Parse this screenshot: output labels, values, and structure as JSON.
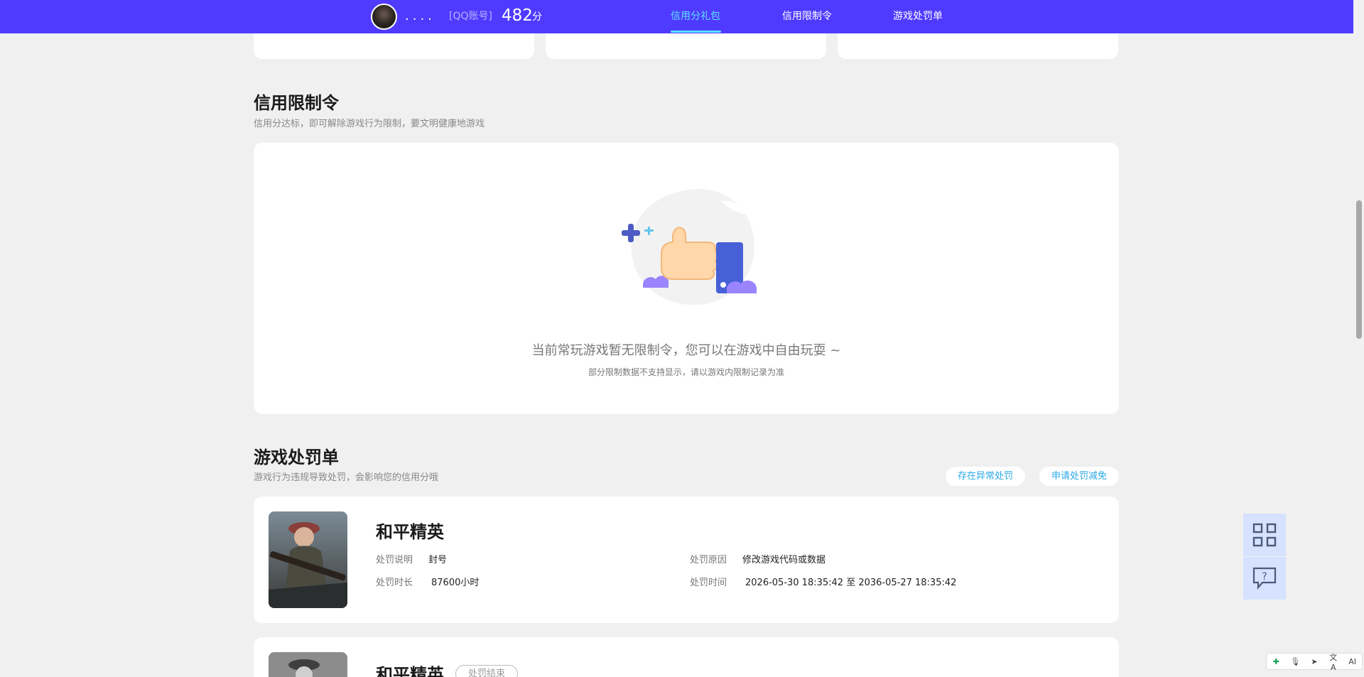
{
  "header": {
    "nickname": "....",
    "account_type": "[QQ账号]",
    "score": "482",
    "score_unit": "分",
    "nav": [
      {
        "label": "信用分礼包",
        "active": true
      },
      {
        "label": "信用限制令",
        "active": false
      },
      {
        "label": "游戏处罚单",
        "active": false
      }
    ]
  },
  "restriction": {
    "title": "信用限制令",
    "subtitle": "信用分达标，即可解除游戏行为限制，要文明健康地游戏",
    "empty_text": "当前常玩游戏暂无限制令，您可以在游戏中自由玩耍 ~",
    "empty_note": "部分限制数据不支持显示，请以游戏内限制记录为准"
  },
  "penalty": {
    "title": "游戏处罚单",
    "subtitle": "游戏行为违规导致处罚，会影响您的信用分哦",
    "buttons": [
      "存在异常处罚",
      "申请处罚减免"
    ],
    "items": [
      {
        "game": "和平精英",
        "labels": {
          "desc": "处罚说明",
          "reason": "处罚原因",
          "duration": "处罚时长",
          "time": "处罚时间"
        },
        "desc": "封号",
        "reason": "修改游戏代码或数据",
        "duration": "87600小时",
        "time": "2026-05-30 18:35:42 至 2036-05-27 18:35:42"
      },
      {
        "game": "和平精英",
        "status": "处罚结束"
      }
    ]
  },
  "floating": {
    "qr_icon": "qr-code-icon",
    "help_icon": "help-chat-icon"
  },
  "mini_toolbar": {
    "translate_label": "文A",
    "ai_label": "AI"
  },
  "colors": {
    "nav_bg": "#4f3bff",
    "nav_active": "#5ce1ff",
    "page_bg": "#f0f0f0",
    "link_blue": "#2aa9e6"
  }
}
